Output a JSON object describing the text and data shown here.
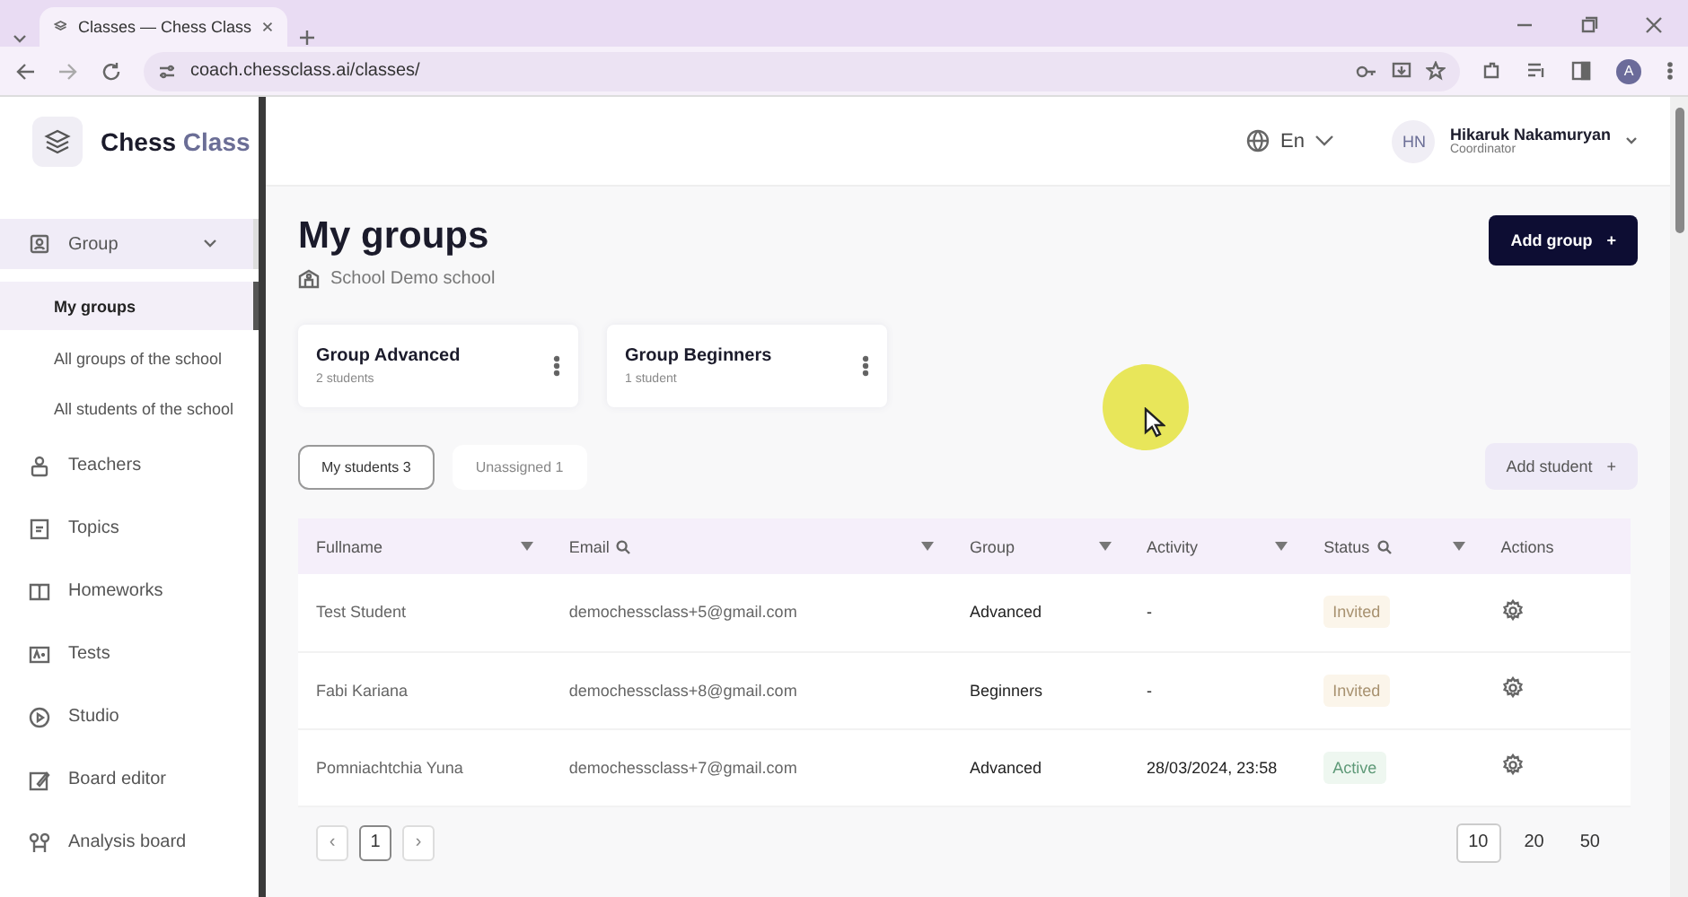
{
  "browser": {
    "tab_title": "Classes — Chess Class",
    "url": "coach.chessclass.ai/classes/",
    "profile_initial": "A"
  },
  "logo": {
    "word_1": "Chess",
    "word_2": "Class"
  },
  "header": {
    "language": "En",
    "user_initials": "HN",
    "user_name": "Hikaruk Nakamuryan",
    "user_role": "Coordinator"
  },
  "sidebar": {
    "items": [
      {
        "label": "Group",
        "expanded": true,
        "selected": false,
        "children": [
          {
            "label": "My groups",
            "selected": true
          },
          {
            "label": "All groups of the school",
            "selected": false
          },
          {
            "label": "All students of the school",
            "selected": false
          }
        ]
      },
      {
        "label": "Teachers",
        "selected": false
      },
      {
        "label": "Topics",
        "selected": false
      },
      {
        "label": "Homeworks",
        "selected": false
      },
      {
        "label": "Tests",
        "selected": false
      },
      {
        "label": "Studio",
        "selected": false
      },
      {
        "label": "Board editor",
        "selected": false
      },
      {
        "label": "Analysis board",
        "selected": false
      }
    ]
  },
  "page": {
    "title": "My groups",
    "school": "School Demo school",
    "add_group": "Add group",
    "add_group_icon": "+"
  },
  "groups": [
    {
      "name": "Group Advanced",
      "count": "2 students"
    },
    {
      "name": "Group Beginners",
      "count": "1 student"
    }
  ],
  "student_tabs": [
    {
      "label": "My students",
      "count": "3",
      "selected": true
    },
    {
      "label": "Unassigned",
      "count": "1",
      "selected": false
    }
  ],
  "add_student": {
    "label": "Add student",
    "icon": "+"
  },
  "table": {
    "columns": [
      {
        "label": "Fullname"
      },
      {
        "label": "Email"
      },
      {
        "label": "Group"
      },
      {
        "label": "Activity"
      },
      {
        "label": "Status"
      },
      {
        "label": "Actions"
      }
    ],
    "rows": [
      {
        "fullname": "Test Student",
        "email": "demochessclass+5@gmail.com",
        "group": "Advanced",
        "activity": "-",
        "status": "Invited",
        "kind": "invited"
      },
      {
        "fullname": "Fabi Kariana",
        "email": "demochessclass+8@gmail.com",
        "group": "Beginners",
        "activity": "-",
        "status": "Invited",
        "kind": "invited"
      },
      {
        "fullname": "Pomniachtchia Yuna",
        "email": "demochessclass+7@gmail.com",
        "group": "Advanced",
        "activity": "28/03/2024, 23:58",
        "status": "Active",
        "kind": "active"
      }
    ]
  },
  "pagination": {
    "prev": "‹",
    "next": "›",
    "pages": [
      {
        "label": "1",
        "selected": true
      }
    ],
    "page_sizes": [
      {
        "label": "10",
        "selected": true
      },
      {
        "label": "20",
        "selected": false
      },
      {
        "label": "50",
        "selected": false
      }
    ]
  }
}
